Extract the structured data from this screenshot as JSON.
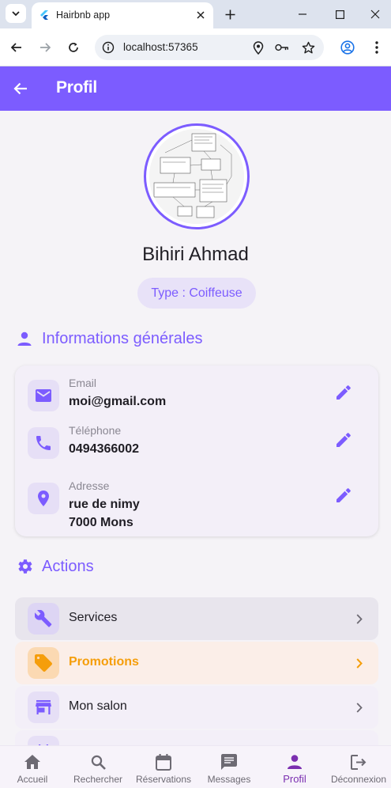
{
  "browser": {
    "tab_title": "Hairbnb app",
    "url": "localhost:57365"
  },
  "appbar": {
    "title": "Profil"
  },
  "profile": {
    "name": "Bihiri Ahmad",
    "type": "Type : Coiffeuse"
  },
  "sections": {
    "general": "Informations générales",
    "actions": "Actions"
  },
  "info": {
    "email_label": "Email",
    "email_value": "moi@gmail.com",
    "phone_label": "Téléphone",
    "phone_value": "0494366002",
    "address_label": "Adresse",
    "address_line1": "rue de nimy",
    "address_line2": "7000 Mons"
  },
  "actions": [
    {
      "label": "Services",
      "icon": "wrench-icon"
    },
    {
      "label": "Promotions",
      "icon": "tag-icon"
    },
    {
      "label": "Mon salon",
      "icon": "store-icon"
    }
  ],
  "bottom_nav": [
    {
      "label": "Accueil",
      "icon": "home-icon"
    },
    {
      "label": "Rechercher",
      "icon": "search-icon"
    },
    {
      "label": "Réservations",
      "icon": "calendar-icon"
    },
    {
      "label": "Messages",
      "icon": "message-icon"
    },
    {
      "label": "Profil",
      "icon": "person-icon"
    },
    {
      "label": "Déconnexion",
      "icon": "logout-icon"
    }
  ],
  "colors": {
    "primary": "#7c5cff",
    "promo_accent": "#f59e0b",
    "active_nav": "#7b2fb0"
  }
}
